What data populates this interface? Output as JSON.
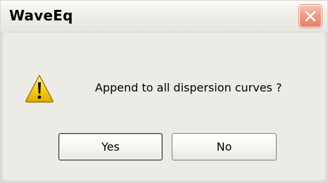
{
  "window": {
    "title": "WaveEq",
    "close_icon": "close-icon"
  },
  "dialog": {
    "icon": "warning-icon",
    "message": "Append to all dispersion curves ?",
    "buttons": {
      "yes_label": "Yes",
      "no_label": "No"
    }
  },
  "colors": {
    "dialog_bg": "#ecebe5",
    "close_button": "#e6806a",
    "warning_yellow": "#f7d21a"
  }
}
